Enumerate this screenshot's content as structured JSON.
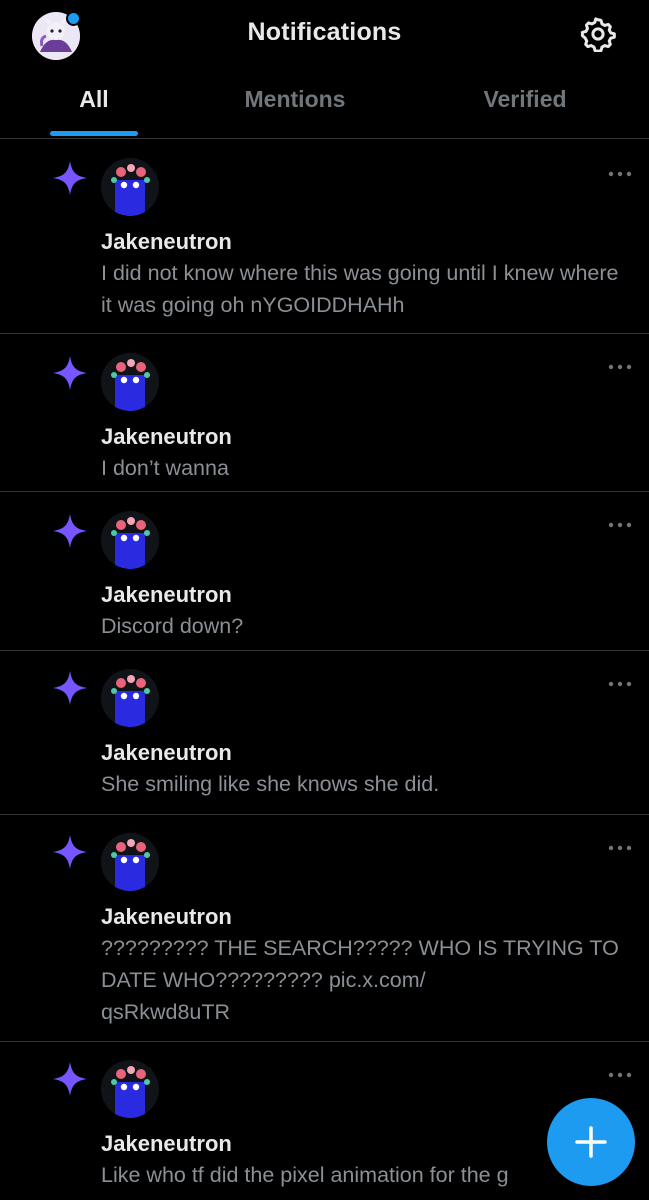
{
  "header": {
    "title": "Notifications",
    "tabs": [
      {
        "label": "All",
        "active": true
      },
      {
        "label": "Mentions",
        "active": false
      },
      {
        "label": "Verified",
        "active": false
      }
    ],
    "icons": [
      "profile-avatar",
      "settings-gear-icon"
    ]
  },
  "notifications": [
    {
      "name": "Jakeneutron",
      "text": "I did not know where this was going until I knew where it was going oh nYGOIDDHAHh"
    },
    {
      "name": "Jakeneutron",
      "text": "I don’t wanna"
    },
    {
      "name": "Jakeneutron",
      "text": "Discord down?"
    },
    {
      "name": "Jakeneutron",
      "text": "She smiling like she knows she did."
    },
    {
      "name": "Jakeneutron",
      "text": "????????? THE SEARCH????? WHO IS TRYING TO DATE WHO????????? pic.x.com/\nqsRkwd8uTR"
    },
    {
      "name": "Jakeneutron",
      "text": "Like who tf did the pixel animation for the g"
    }
  ],
  "colors": {
    "accent": "#1d9bf0",
    "sparkle": "#7856ff",
    "background": "#000000",
    "divider": "#2f3336"
  },
  "fab": {
    "icon": "plus-icon"
  }
}
